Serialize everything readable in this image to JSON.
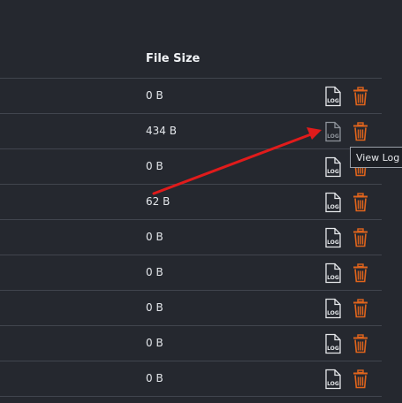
{
  "table": {
    "header_file_size": "File Size",
    "rows": [
      {
        "size": "0 B"
      },
      {
        "size": "434 B"
      },
      {
        "size": "0 B"
      },
      {
        "size": "62 B"
      },
      {
        "size": "0 B"
      },
      {
        "size": "0 B"
      },
      {
        "size": "0 B"
      },
      {
        "size": "0 B"
      },
      {
        "size": "0 B"
      }
    ],
    "log_icon_label": "LOG"
  },
  "tooltip": {
    "text": "View Log"
  },
  "colors": {
    "background": "#25282f",
    "divider": "#41454e",
    "trash_icon": "#e0641c",
    "annotation_arrow": "#e01b1b"
  },
  "icons": {
    "view_log": "log-file-icon",
    "delete": "trash-icon"
  }
}
